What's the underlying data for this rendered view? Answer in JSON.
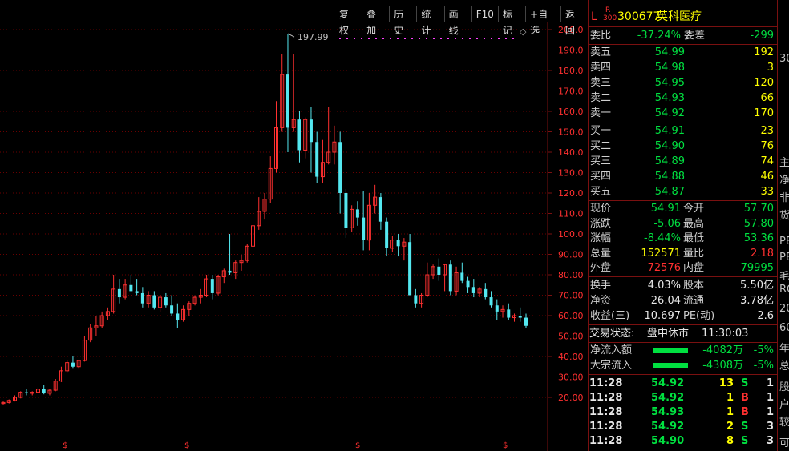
{
  "toolbar": [
    "复权",
    "叠加",
    "历史",
    "统计",
    "画线",
    "F10",
    "标记",
    "+自选",
    "返回"
  ],
  "chart": {
    "y_ticks": [
      "200.0",
      "190.0",
      "180.0",
      "170.0",
      "160.0",
      "150.0",
      "140.0",
      "130.0",
      "120.0",
      "110.0",
      "100.0",
      "90.00",
      "80.00",
      "70.00",
      "60.00",
      "50.00",
      "40.00",
      "30.00",
      "20.00"
    ],
    "peak_label": "197.99",
    "dollar_marker": "$",
    "diamond": "◇"
  },
  "chart_data": {
    "type": "candlestick",
    "y_axis": {
      "min": 12,
      "max": 203,
      "scale": "linear",
      "tick_step": 10
    },
    "max_label": 197.99,
    "candles": [
      [
        17,
        18,
        16.5,
        17.5
      ],
      [
        17.5,
        19,
        17,
        18.5
      ],
      [
        18.5,
        21,
        18,
        20
      ],
      [
        20,
        23,
        19.5,
        22.5
      ],
      [
        22.5,
        24,
        21,
        22
      ],
      [
        22,
        23,
        21,
        22.5
      ],
      [
        22.5,
        25,
        22,
        24
      ],
      [
        24,
        26,
        21.5,
        22
      ],
      [
        22,
        24,
        21,
        23.5
      ],
      [
        23.5,
        29,
        23,
        28
      ],
      [
        28,
        35,
        27.5,
        33
      ],
      [
        33,
        38,
        32,
        37
      ],
      [
        37,
        40,
        34,
        35
      ],
      [
        35,
        38,
        34,
        38
      ],
      [
        38,
        50,
        37.5,
        48
      ],
      [
        48,
        56,
        47,
        54
      ],
      [
        54,
        60,
        50,
        55
      ],
      [
        55,
        62,
        54,
        60
      ],
      [
        60,
        64,
        58,
        62
      ],
      [
        62,
        80,
        61,
        73
      ],
      [
        73,
        78,
        66,
        69
      ],
      [
        69,
        78,
        68,
        75
      ],
      [
        75,
        80,
        72,
        72
      ],
      [
        72,
        78,
        70,
        71
      ],
      [
        71,
        74,
        64,
        66
      ],
      [
        66,
        72,
        64,
        70
      ],
      [
        70,
        72,
        63,
        64
      ],
      [
        64,
        70,
        62,
        69
      ],
      [
        69,
        71,
        64,
        65
      ],
      [
        65,
        70,
        60,
        61
      ],
      [
        61,
        66,
        54,
        58
      ],
      [
        58,
        65,
        57,
        63
      ],
      [
        63,
        67,
        60,
        66
      ],
      [
        66,
        70,
        65,
        69
      ],
      [
        69,
        73,
        66,
        70
      ],
      [
        70,
        80,
        69,
        78
      ],
      [
        78,
        80,
        68,
        71
      ],
      [
        71,
        80,
        70,
        79
      ],
      [
        79,
        83,
        76,
        82
      ],
      [
        82,
        100,
        80,
        81
      ],
      [
        81,
        87,
        78,
        86
      ],
      [
        86,
        90,
        82,
        87
      ],
      [
        87,
        95,
        86,
        94
      ],
      [
        94,
        110,
        93,
        104
      ],
      [
        104,
        118,
        102,
        111
      ],
      [
        111,
        120,
        107,
        117
      ],
      [
        117,
        138,
        115,
        132
      ],
      [
        132,
        165,
        130,
        152
      ],
      [
        152,
        188,
        150,
        178
      ],
      [
        178,
        198,
        140,
        152
      ],
      [
        152,
        188,
        150,
        156
      ],
      [
        156,
        160,
        135,
        141
      ],
      [
        141,
        157,
        137,
        156
      ],
      [
        156,
        162,
        130,
        145
      ],
      [
        145,
        150,
        125,
        128
      ],
      [
        128,
        146,
        125,
        135
      ],
      [
        135,
        162,
        134,
        140
      ],
      [
        140,
        153,
        134,
        145
      ],
      [
        145,
        150,
        110,
        120
      ],
      [
        120,
        122,
        98,
        103
      ],
      [
        103,
        114,
        101,
        112
      ],
      [
        112,
        116,
        104,
        108
      ],
      [
        108,
        121,
        92,
        97
      ],
      [
        97,
        120,
        92,
        114
      ],
      [
        114,
        124,
        110,
        118
      ],
      [
        118,
        120,
        102,
        106
      ],
      [
        106,
        108,
        89,
        93
      ],
      [
        93,
        99,
        91,
        97
      ],
      [
        97,
        100,
        89,
        94
      ],
      [
        94,
        98,
        87,
        96
      ],
      [
        96,
        100,
        70,
        70
      ],
      [
        70,
        73,
        64,
        66
      ],
      [
        66,
        71,
        64,
        70
      ],
      [
        70,
        86,
        69,
        80
      ],
      [
        80,
        85,
        78,
        84
      ],
      [
        84,
        88,
        77,
        80
      ],
      [
        80,
        85,
        72,
        85
      ],
      [
        85,
        87,
        70,
        72
      ],
      [
        72,
        84,
        70,
        81
      ],
      [
        81,
        86,
        76,
        77
      ],
      [
        77,
        79,
        71,
        74
      ],
      [
        74,
        78,
        69,
        71
      ],
      [
        71,
        74,
        69,
        73
      ],
      [
        73,
        76,
        68,
        69
      ],
      [
        69,
        72,
        64,
        65
      ],
      [
        65,
        68,
        58,
        62
      ],
      [
        62,
        65,
        59,
        63
      ],
      [
        63,
        66,
        58,
        59
      ],
      [
        59,
        61,
        57,
        60
      ],
      [
        60,
        64,
        57,
        59
      ],
      [
        59,
        61,
        54,
        55
      ]
    ]
  },
  "stock": {
    "prefix": "L",
    "r_label": "R",
    "r_num": "300",
    "code": "300677",
    "name": "英科医疗"
  },
  "weibi": {
    "label": "委比",
    "value": "-37.24%",
    "label2": "委差",
    "value2": "-299"
  },
  "asks": [
    {
      "label": "卖五",
      "price": "54.99",
      "vol": "192"
    },
    {
      "label": "卖四",
      "price": "54.98",
      "vol": "3"
    },
    {
      "label": "卖三",
      "price": "54.95",
      "vol": "120"
    },
    {
      "label": "卖二",
      "price": "54.93",
      "vol": "66"
    },
    {
      "label": "卖一",
      "price": "54.92",
      "vol": "170"
    }
  ],
  "bids": [
    {
      "label": "买一",
      "price": "54.91",
      "vol": "23"
    },
    {
      "label": "买二",
      "price": "54.90",
      "vol": "76"
    },
    {
      "label": "买三",
      "price": "54.89",
      "vol": "74"
    },
    {
      "label": "买四",
      "price": "54.88",
      "vol": "46"
    },
    {
      "label": "买五",
      "price": "54.87",
      "vol": "33"
    }
  ],
  "quote": [
    {
      "l1": "现价",
      "v1": "54.91",
      "c1": "green",
      "l2": "今开",
      "v2": "57.70",
      "c2": "green"
    },
    {
      "l1": "涨跌",
      "v1": "-5.06",
      "c1": "green",
      "l2": "最高",
      "v2": "57.80",
      "c2": "green"
    },
    {
      "l1": "涨幅",
      "v1": "-8.44%",
      "c1": "green",
      "l2": "最低",
      "v2": "53.36",
      "c2": "green"
    },
    {
      "l1": "总量",
      "v1": "152571",
      "c1": "yellow",
      "l2": "量比",
      "v2": "2.18",
      "c2": "red"
    },
    {
      "l1": "外盘",
      "v1": "72576",
      "c1": "red",
      "l2": "内盘",
      "v2": "79995",
      "c2": "green"
    }
  ],
  "fund": [
    {
      "l1": "换手",
      "v1": "4.03%",
      "l2": "股本",
      "v2": "5.50亿"
    },
    {
      "l1": "净资",
      "v1": "26.04",
      "l2": "流通",
      "v2": "3.78亿"
    },
    {
      "l1": "收益(三)",
      "v1": "10.697",
      "l2": "PE(动)",
      "v2": "2.6"
    }
  ],
  "status": {
    "label": "交易状态:",
    "value": "盘中休市",
    "time": "11:30:03"
  },
  "flow": [
    {
      "label": "净流入额",
      "value": "-4082万",
      "pct": "-5%",
      "frac": 0.05
    },
    {
      "label": "大宗流入",
      "value": "-4308万",
      "pct": "-5%",
      "frac": 0.05
    }
  ],
  "ticks": [
    {
      "time": "11:28",
      "price": "54.92",
      "vol": "13",
      "side": "S",
      "n": "1"
    },
    {
      "time": "11:28",
      "price": "54.92",
      "vol": "1",
      "side": "B",
      "n": "1"
    },
    {
      "time": "11:28",
      "price": "54.93",
      "vol": "1",
      "side": "B",
      "n": "1"
    },
    {
      "time": "11:28",
      "price": "54.92",
      "vol": "2",
      "side": "S",
      "n": "3"
    },
    {
      "time": "11:28",
      "price": "54.90",
      "vol": "8",
      "side": "S",
      "n": "3"
    }
  ],
  "edge_text": [
    "30",
    "主",
    "净",
    "非",
    "货",
    "PE",
    "PE",
    "毛",
    "RO",
    "20",
    "60",
    "年",
    "总",
    "股",
    "户",
    "较",
    "可"
  ],
  "colors": {
    "up": "#ff3030",
    "down": "#54e8f0",
    "border": "#7a1010",
    "grid": "#6a0000"
  }
}
